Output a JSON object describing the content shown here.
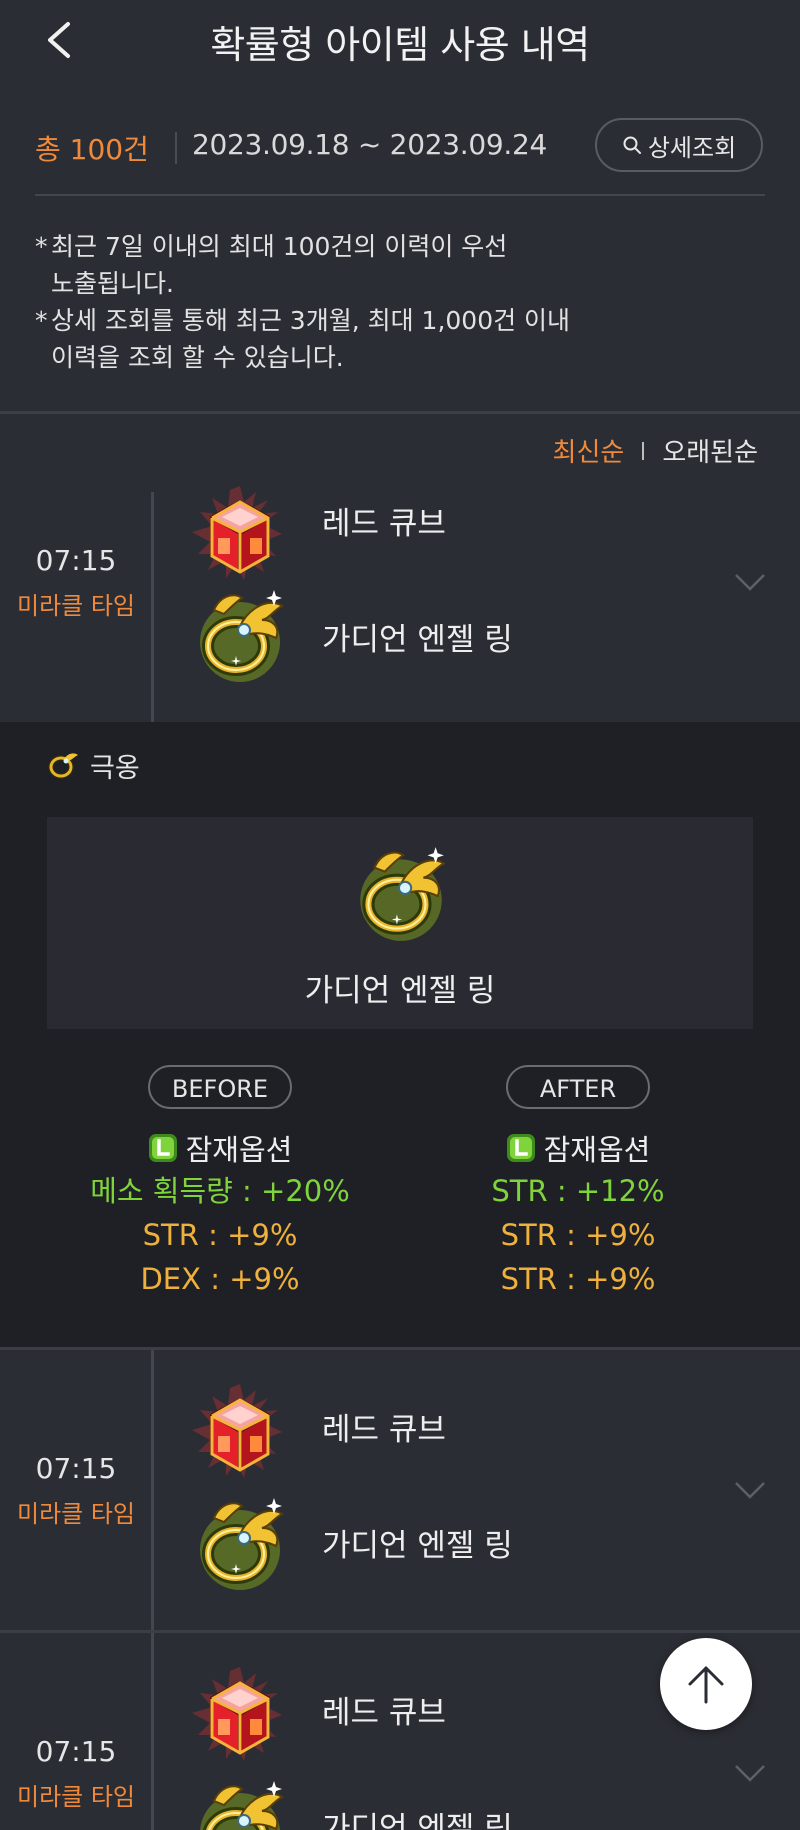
{
  "header": {
    "title": "확률형 아이템 사용 내역",
    "back_icon": "chevron-left-icon"
  },
  "summary": {
    "total": "총 100건",
    "date_range": "2023.09.18 ~ 2023.09.24",
    "detail_button": "상세조회",
    "detail_icon": "search-icon"
  },
  "notices": [
    {
      "star": "*",
      "line1": "최근 7일 이내의 최대 100건의 이력이 우선",
      "line2": "노출됩니다."
    },
    {
      "star": "*",
      "line1": "상세 조회를 통해 최근 3개월, 최대 1,000건 이내",
      "line2": "이력을 조회 할 수 있습니다."
    }
  ],
  "sort": {
    "newest": "최신순",
    "oldest": "오래된순",
    "active": "최신순"
  },
  "entries": [
    {
      "time": "07:15",
      "event": "미라클 타임",
      "cube": "레드 큐브",
      "item": "가디언 엔젤 링"
    },
    {
      "time": "07:15",
      "event": "미라클 타임",
      "cube": "레드 큐브",
      "item": "가디언 엔젤 링"
    },
    {
      "time": "07:15",
      "event": "미라클 타임",
      "cube": "레드 큐브",
      "item": "가디언 엔젤 링"
    }
  ],
  "detail": {
    "grade": "극옹",
    "item_name": "가디언 엔젤 링",
    "before": {
      "label": "BEFORE",
      "title": "잠재옵션",
      "options": [
        "메소 획득량 : +20%",
        "STR : +9%",
        "DEX : +9%"
      ]
    },
    "after": {
      "label": "AFTER",
      "title": "잠재옵션",
      "options": [
        "STR : +12%",
        "STR : +9%",
        "STR : +9%"
      ]
    }
  },
  "colors": {
    "accent_orange": "#f08a3a",
    "option_green": "#7fd33b",
    "option_gold": "#efb13c",
    "background": "#2b2d34",
    "panel": "#1f2025"
  },
  "fab_icon": "arrow-up-icon"
}
